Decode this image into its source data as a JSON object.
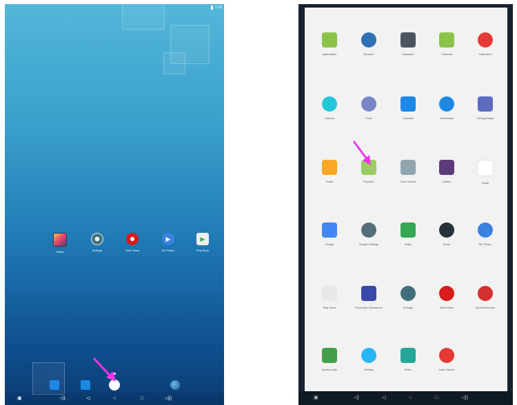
{
  "left_screen": {
    "status": {
      "clock": "1:06"
    },
    "home_apps": [
      {
        "label": "Gallery",
        "icon": "gallery-icon",
        "color": "#5b3b7a"
      },
      {
        "label": "Settings",
        "icon": "settings-icon",
        "color": "#3f6f7a"
      },
      {
        "label": "Slide Show",
        "icon": "slideshow-icon",
        "color": "#d81b1b"
      },
      {
        "label": "MX Player",
        "icon": "mx-player-icon",
        "color": "#3b82e0"
      },
      {
        "label": "Play Store",
        "icon": "play-store-icon",
        "color": "#e8e8e8"
      }
    ],
    "hotseat": [
      {
        "icon": "contacts-icon"
      },
      {
        "icon": "contacts-icon"
      },
      {
        "icon": "all-apps-icon"
      },
      {
        "icon": "browser-icon"
      }
    ],
    "nav": {
      "back": "◁",
      "home": "○",
      "recents": "□",
      "volume_down": "◁)",
      "volume_up": "◁))",
      "screenshot": "▣"
    }
  },
  "right_screen": {
    "apps": [
      {
        "label": "ApkInstaller",
        "icon": "android-installer-icon",
        "color": "#8bc34a"
      },
      {
        "label": "Browser",
        "icon": "globe-icon",
        "color": "#2f6fb5"
      },
      {
        "label": "Calculator",
        "icon": "calculator-icon",
        "color": "#4a5560"
      },
      {
        "label": "Calendar",
        "icon": "calendar-icon",
        "color": "#8bc34a"
      },
      {
        "label": "Calibration",
        "icon": "target-icon",
        "color": "#e53935"
      },
      {
        "label": "Camera",
        "icon": "camera-icon",
        "color": "#26c6da"
      },
      {
        "label": "Clock",
        "icon": "clock-icon",
        "color": "#7986cb"
      },
      {
        "label": "Contacts",
        "icon": "contacts-icon",
        "color": "#1e88e5"
      },
      {
        "label": "Downloads",
        "icon": "download-icon",
        "color": "#1e88e5"
      },
      {
        "label": "GDAppInstall",
        "icon": "app-install-icon",
        "color": "#5c6bc0"
      },
      {
        "label": "Email",
        "icon": "email-icon",
        "color": "#f9a825"
      },
      {
        "label": "Explorer",
        "icon": "explorer-icon",
        "color": "#9ccc65"
      },
      {
        "label": "Face Search",
        "icon": "robot-face-icon",
        "color": "#90a4ae"
      },
      {
        "label": "Gallery",
        "icon": "gallery-icon",
        "color": "#5b3b7a"
      },
      {
        "label": "Gmail",
        "icon": "gmail-icon",
        "color": "#ffffff"
      },
      {
        "label": "Google",
        "icon": "google-icon",
        "color": "#4285f4"
      },
      {
        "label": "Google Settings",
        "icon": "google-settings-icon",
        "color": "#546e7a"
      },
      {
        "label": "Maps",
        "icon": "maps-icon",
        "color": "#34a853"
      },
      {
        "label": "Music",
        "icon": "music-icon",
        "color": "#263238"
      },
      {
        "label": "MX Player",
        "icon": "mx-player-icon",
        "color": "#3b82e0"
      },
      {
        "label": "Play Store",
        "icon": "play-store-icon",
        "color": "#e8e8e8"
      },
      {
        "label": "Rockchips Experience",
        "icon": "rk-icon",
        "color": "#3949ab"
      },
      {
        "label": "Settings",
        "icon": "settings-icon",
        "color": "#3f6f7a"
      },
      {
        "label": "Slide Show",
        "icon": "slideshow-icon",
        "color": "#d81b1b"
      },
      {
        "label": "Sound Recorder",
        "icon": "microphone-icon",
        "color": "#d32f2f"
      },
      {
        "label": "System-aide",
        "icon": "android-icon",
        "color": "#43a047"
      },
      {
        "label": "TestApp",
        "icon": "testapp-icon",
        "color": "#29b6f6"
      },
      {
        "label": "Video",
        "icon": "video-icon",
        "color": "#26a69a"
      },
      {
        "label": "Voice Search",
        "icon": "voice-search-icon",
        "color": "#e53935"
      }
    ],
    "nav": {
      "back": "◁",
      "home": "○",
      "recents": "□",
      "volume_down": "◁)",
      "volume_up": "◁))",
      "screenshot": "▣"
    }
  },
  "accent": {
    "arrow": "#ec38e8"
  }
}
